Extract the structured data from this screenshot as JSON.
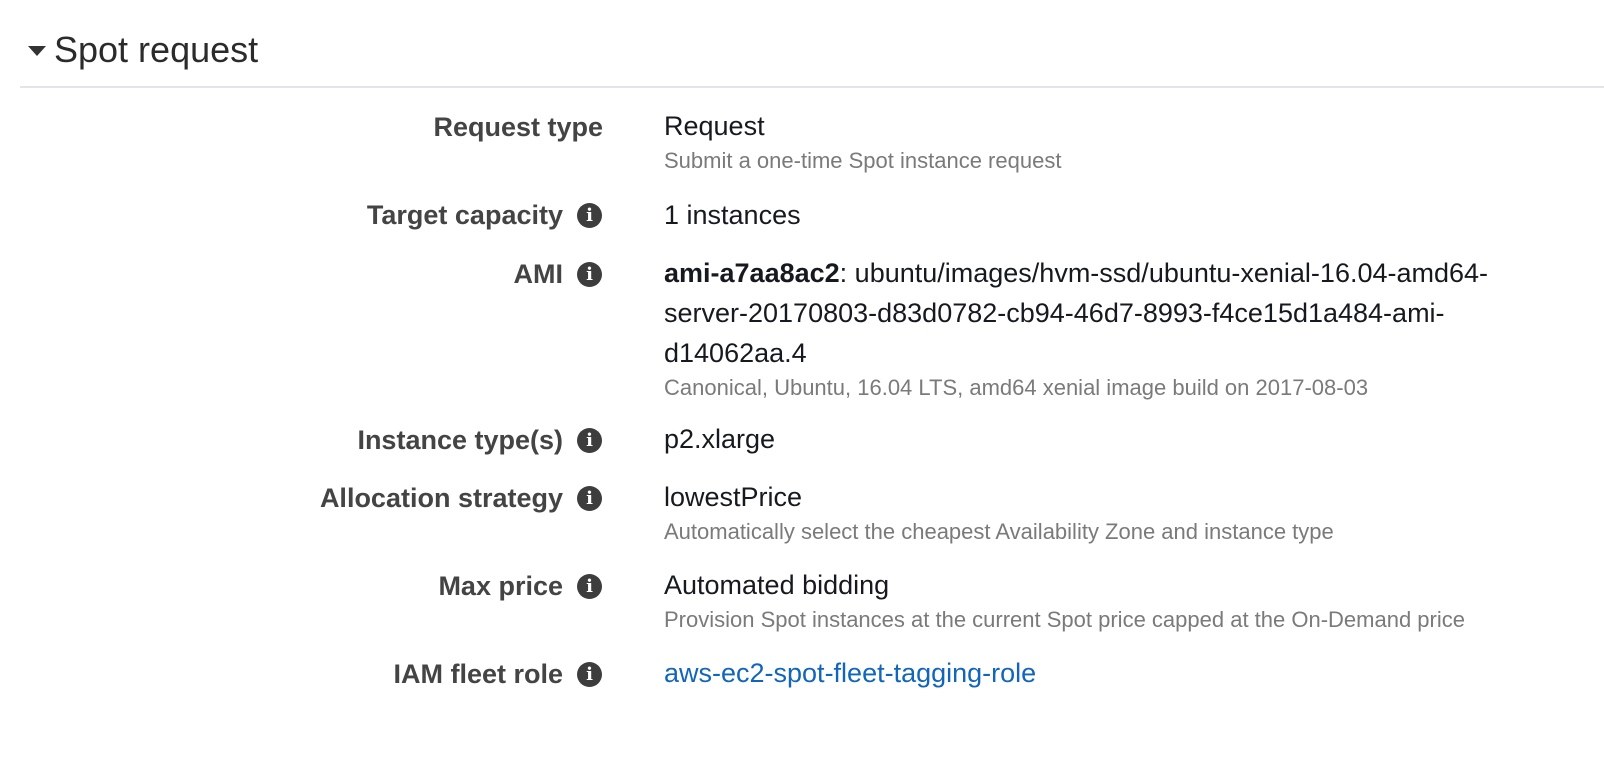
{
  "section": {
    "title": "Spot request"
  },
  "rows": {
    "request_type": {
      "label": "Request type",
      "value": "Request",
      "description": "Submit a one-time Spot instance request"
    },
    "target_capacity": {
      "label": "Target capacity",
      "value": "1 instances"
    },
    "ami": {
      "label": "AMI",
      "ami_id": "ami-a7aa8ac2",
      "ami_sep": ":",
      "value_line1": " ubuntu/images/hvm-ssd/ubuntu-xenial-16.04-amd64-",
      "value_line2": "server-20170803-d83d0782-cb94-46d7-8993-f4ce15d1a484-ami-",
      "value_line3": "d14062aa.4",
      "description": "Canonical, Ubuntu, 16.04 LTS, amd64 xenial image build on 2017-08-03"
    },
    "instance_types": {
      "label": "Instance type(s)",
      "value": "p2.xlarge"
    },
    "allocation_strategy": {
      "label": "Allocation strategy",
      "value": "lowestPrice",
      "description": "Automatically select the cheapest Availability Zone and instance type"
    },
    "max_price": {
      "label": "Max price",
      "value": "Automated bidding",
      "description": "Provision Spot instances at the current Spot price capped at the On-Demand price"
    },
    "iam_fleet_role": {
      "label": "IAM fleet role",
      "value": "aws-ec2-spot-fleet-tagging-role"
    }
  },
  "icons": {
    "info_glyph": "i",
    "caret": "caret-down-icon"
  },
  "colors": {
    "link": "#1166bb",
    "label": "#444444",
    "description": "#7a7a7a",
    "info_icon_bg": "#3d3d3d",
    "divider": "#e1e4e8"
  }
}
